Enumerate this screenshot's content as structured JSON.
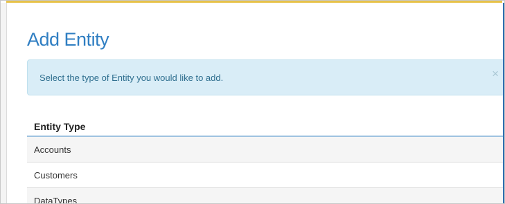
{
  "dialog": {
    "title": "Add Entity",
    "alert_message": "Select the type of Entity you would like to add.",
    "alert_close": "×"
  },
  "table": {
    "header": "Entity Type",
    "rows": [
      "Accounts",
      "Customers",
      "DataTypes"
    ]
  },
  "colors": {
    "title": "#2f7ec2",
    "alert_bg": "#d9edf7",
    "header_rule": "#9ec3e0",
    "accent_top": "#e7c24a"
  }
}
